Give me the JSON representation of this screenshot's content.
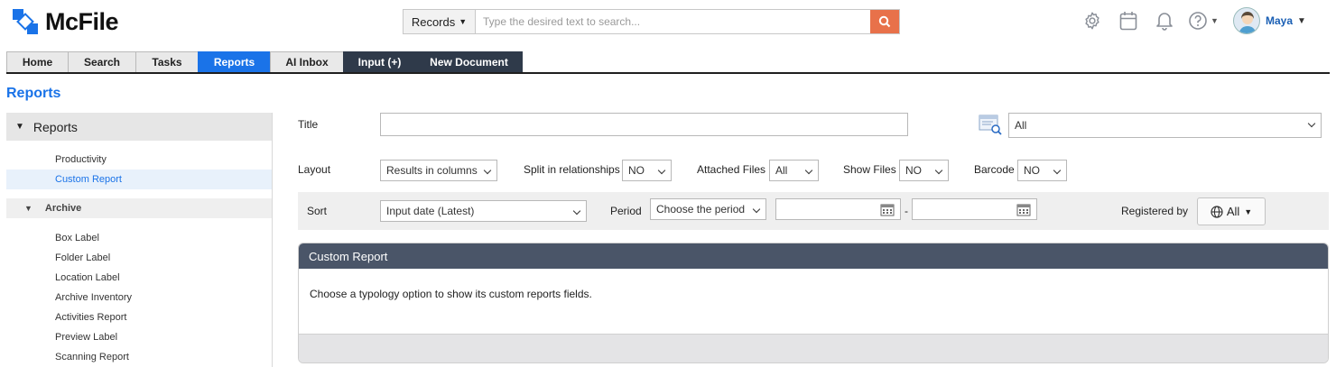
{
  "app": {
    "name": "McFile"
  },
  "search": {
    "scope": "Records",
    "placeholder": "Type the desired text to search..."
  },
  "user": {
    "name": "Maya"
  },
  "tabs": [
    {
      "label": "Home"
    },
    {
      "label": "Search"
    },
    {
      "label": "Tasks"
    },
    {
      "label": "Reports"
    },
    {
      "label": "AI Inbox"
    },
    {
      "label": "Input (+)"
    },
    {
      "label": "New Document"
    }
  ],
  "page_title": "Reports",
  "sidebar": {
    "header": "Reports",
    "items": [
      "Productivity",
      "Custom Report"
    ],
    "archive_header": "Archive",
    "archive_items": [
      "Box Label",
      "Folder Label",
      "Location Label",
      "Archive Inventory",
      "Activities Report",
      "Preview Label",
      "Scanning Report"
    ]
  },
  "form": {
    "title_label": "Title",
    "title_value": "",
    "filter_value": "All",
    "layout_label": "Layout",
    "layout_value": "Results in columns",
    "split_label": "Split in relationships",
    "split_value": "NO",
    "attached_label": "Attached Files",
    "attached_value": "All",
    "showfiles_label": "Show Files",
    "showfiles_value": "NO",
    "barcode_label": "Barcode",
    "barcode_value": "NO",
    "sort_label": "Sort",
    "sort_value": "Input date (Latest)",
    "period_label": "Period",
    "period_value": "Choose the period",
    "date_separator": "-",
    "registered_label": "Registered by",
    "registered_value": "All"
  },
  "panel": {
    "title": "Custom Report",
    "message": "Choose a typology option to show its custom reports fields."
  },
  "colors": {
    "accent": "#1a73e8",
    "search_button": "#e8714a",
    "dark_tab": "#2f3a4a",
    "panel_header": "#4a5568"
  }
}
